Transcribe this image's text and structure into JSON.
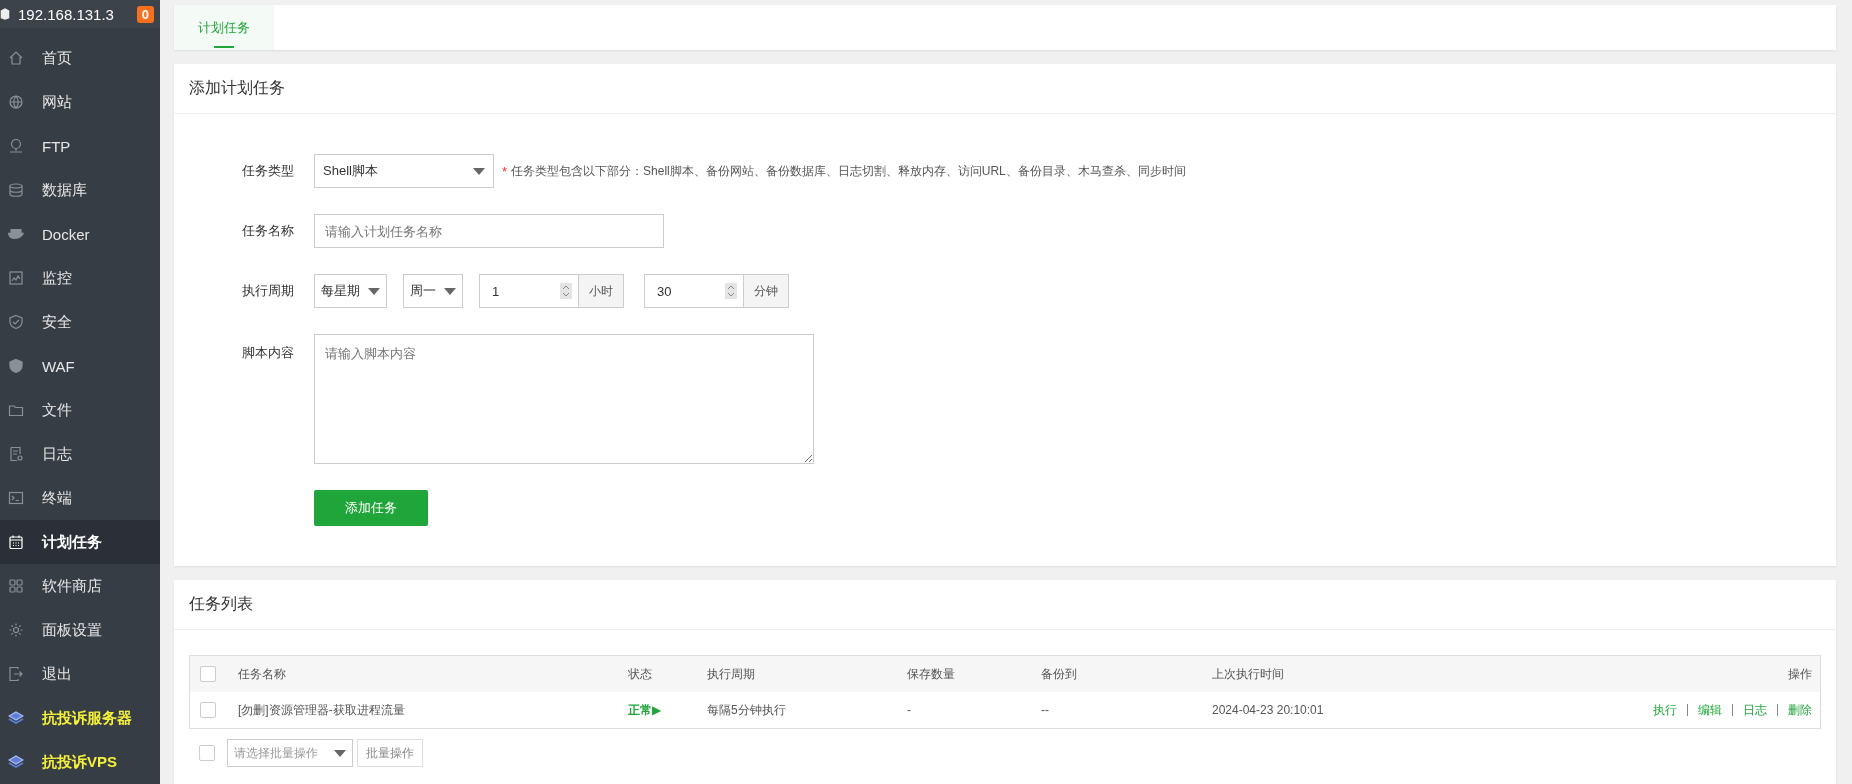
{
  "sidebar": {
    "host": "192.168.131.3",
    "badge": "0",
    "items": [
      {
        "label": "首页",
        "selected": false,
        "kind": "nav"
      },
      {
        "label": "网站",
        "selected": false,
        "kind": "nav"
      },
      {
        "label": "FTP",
        "selected": false,
        "kind": "nav"
      },
      {
        "label": "数据库",
        "selected": false,
        "kind": "nav"
      },
      {
        "label": "Docker",
        "selected": false,
        "kind": "nav"
      },
      {
        "label": "监控",
        "selected": false,
        "kind": "nav"
      },
      {
        "label": "安全",
        "selected": false,
        "kind": "nav"
      },
      {
        "label": "WAF",
        "selected": false,
        "kind": "nav"
      },
      {
        "label": "文件",
        "selected": false,
        "kind": "nav"
      },
      {
        "label": "日志",
        "selected": false,
        "kind": "nav"
      },
      {
        "label": "终端",
        "selected": false,
        "kind": "nav"
      },
      {
        "label": "计划任务",
        "selected": true,
        "kind": "nav"
      },
      {
        "label": "软件商店",
        "selected": false,
        "kind": "nav"
      },
      {
        "label": "面板设置",
        "selected": false,
        "kind": "nav"
      },
      {
        "label": "退出",
        "selected": false,
        "kind": "nav"
      },
      {
        "label": "抗投诉服务器",
        "selected": false,
        "kind": "promo"
      },
      {
        "label": "抗投诉VPS",
        "selected": false,
        "kind": "promo"
      }
    ]
  },
  "tabs": [
    {
      "label": "计划任务",
      "selected": true
    }
  ],
  "add_form": {
    "title": "添加计划任务",
    "task_type": {
      "label": "任务类型",
      "value": "Shell脚本",
      "required_mark": "*",
      "hint": "任务类型包含以下部分：Shell脚本、备份网站、备份数据库、日志切割、释放内存、访问URL、备份目录、木马查杀、同步时间"
    },
    "task_name": {
      "label": "任务名称",
      "placeholder": "请输入计划任务名称"
    },
    "period": {
      "label": "执行周期",
      "frequency": "每星期",
      "weekday": "周一",
      "hour": "1",
      "hour_unit": "小时",
      "minute": "30",
      "minute_unit": "分钟"
    },
    "script": {
      "label": "脚本内容",
      "placeholder": "请输入脚本内容"
    },
    "submit": "添加任务"
  },
  "task_list": {
    "title": "任务列表",
    "select_all_checked": false,
    "columns": [
      "任务名称",
      "状态",
      "执行周期",
      "保存数量",
      "备份到",
      "上次执行时间",
      "操作"
    ],
    "rows": [
      {
        "checked": false,
        "name": "[勿删]资源管理器-获取进程流量",
        "status": "正常▶",
        "period": "每隔5分钟执行",
        "keep": "-",
        "backup_to": "--",
        "last_run": "2024-04-23 20:10:01",
        "actions": [
          "执行",
          "编辑",
          "日志",
          "删除"
        ]
      }
    ],
    "batch": {
      "checked": false,
      "placeholder": "请选择批量操作",
      "button": "批量操作"
    }
  }
}
